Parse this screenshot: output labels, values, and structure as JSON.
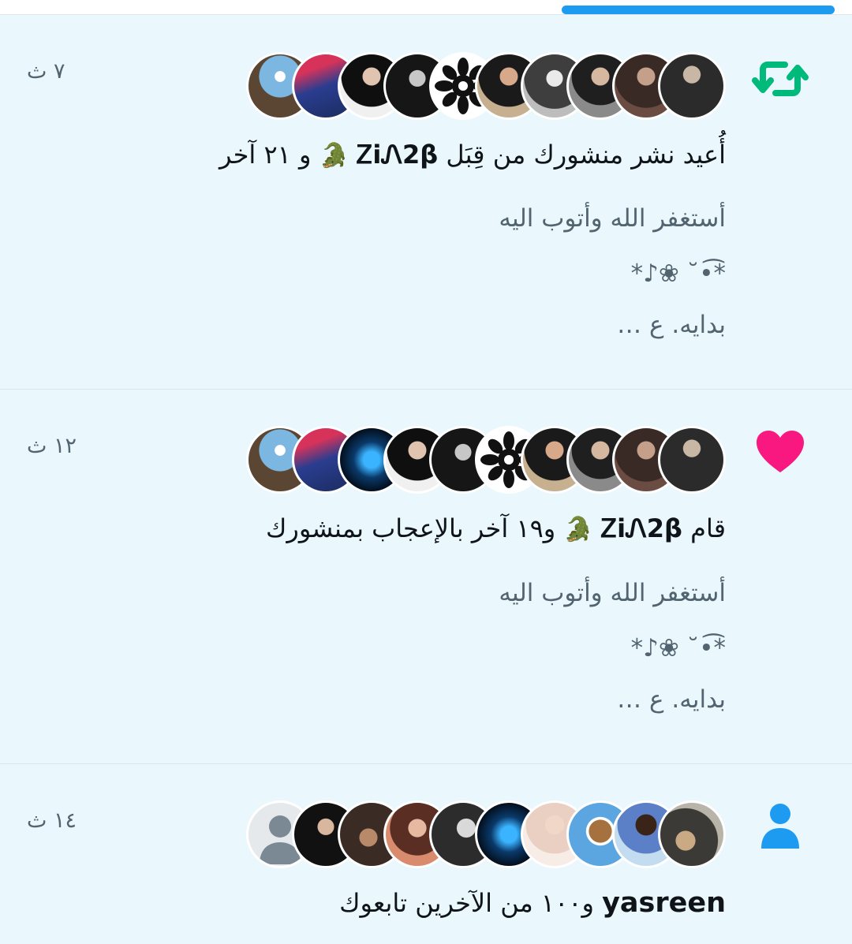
{
  "notifications": [
    {
      "type": "retweet",
      "icon": "retweet-icon",
      "time": "٧ ث",
      "actor": "ᏃiᏁ2β",
      "emoji": "🐊",
      "prefix": "أُعيد نشر منشورك من قِبَل",
      "suffix": "و ٢١ آخر",
      "body": [
        "أستغفر الله وأتوب اليه",
        "*•͡˘ ❀♪*",
        "بدايه. ع …"
      ],
      "avatar_count": 10
    },
    {
      "type": "like",
      "icon": "heart-icon",
      "time": "١٢ ث",
      "prefix": "قام",
      "actor": "ᏃiᏁ2β",
      "emoji": "🐊",
      "suffix": "و١٩ آخر بالإعجاب بمنشورك",
      "body": [
        "أستغفر الله وأتوب اليه",
        "*•͡˘ ❀♪*",
        "بدايه. ع …"
      ],
      "avatar_count": 11
    },
    {
      "type": "follow",
      "icon": "person-icon",
      "time": "١٤ ث",
      "actor": "yasreen",
      "suffix": "و١٠٠ من الآخرين تابعوك",
      "avatar_count": 11
    }
  ],
  "colors": {
    "retweet": "#00ba7c",
    "like": "#f91880",
    "follow": "#1d9bf0",
    "accent": "#1d9bf0",
    "background": "#eaf7fd"
  }
}
